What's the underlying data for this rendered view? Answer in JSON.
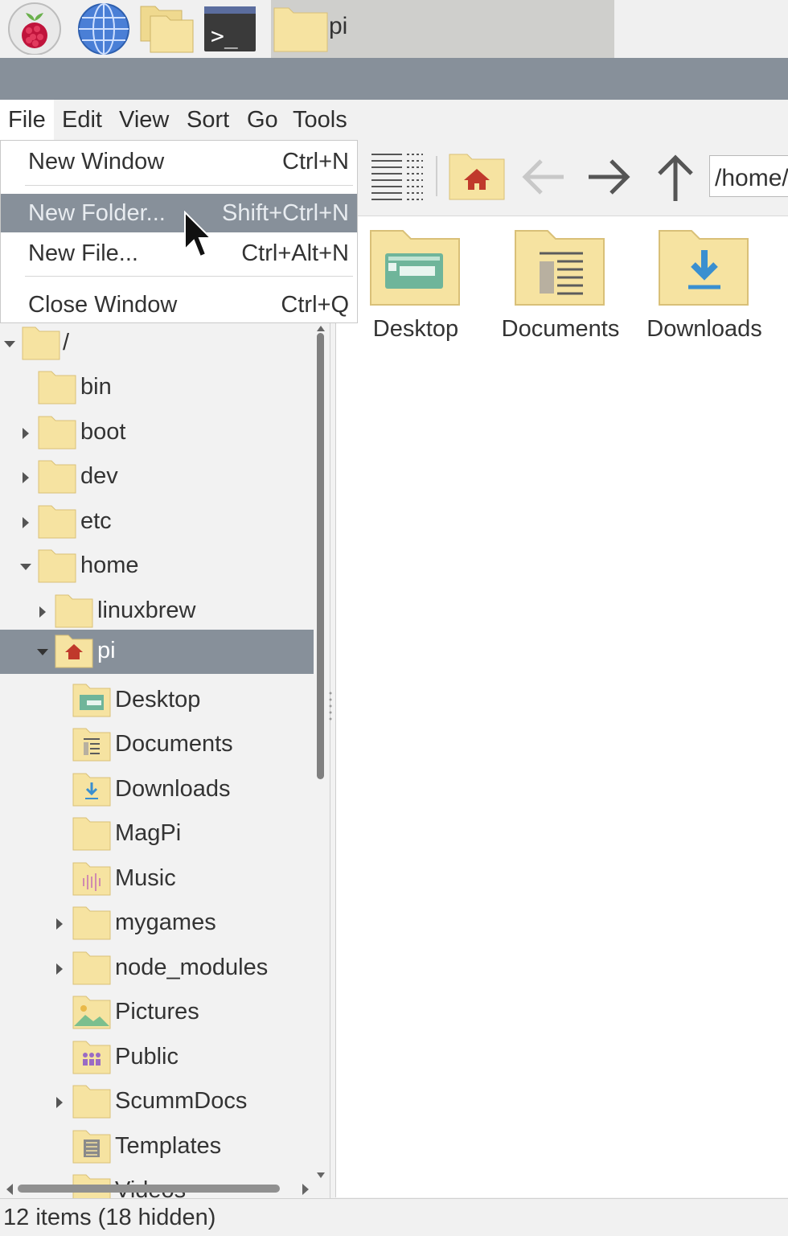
{
  "taskbar": {
    "launchers": [
      "raspberry-menu",
      "web-browser",
      "file-manager",
      "terminal"
    ],
    "terminal_glyph": ">_",
    "task_label": "pi"
  },
  "menubar": {
    "items": [
      "File",
      "Edit",
      "View",
      "Sort",
      "Go",
      "Tools"
    ]
  },
  "file_menu": {
    "items": [
      {
        "label": "New Window",
        "accel": "Ctrl+N"
      },
      {
        "label": "New Folder...",
        "accel": "Shift+Ctrl+N"
      },
      {
        "label": "New File...",
        "accel": "Ctrl+Alt+N"
      },
      {
        "label": "Close Window",
        "accel": "Ctrl+Q"
      }
    ]
  },
  "toolbar": {
    "path_value": "/home/pi"
  },
  "main": {
    "items": [
      {
        "label": "Desktop",
        "icon": "desktop-folder-icon"
      },
      {
        "label": "Documents",
        "icon": "documents-folder-icon"
      },
      {
        "label": "Downloads",
        "icon": "downloads-folder-icon"
      }
    ]
  },
  "tree": {
    "rows": [
      {
        "label": "/"
      },
      {
        "label": "bin"
      },
      {
        "label": "boot"
      },
      {
        "label": "dev"
      },
      {
        "label": "etc"
      },
      {
        "label": "home"
      },
      {
        "label": "linuxbrew"
      },
      {
        "label": "pi"
      },
      {
        "label": "Desktop"
      },
      {
        "label": "Documents"
      },
      {
        "label": "Downloads"
      },
      {
        "label": "MagPi"
      },
      {
        "label": "Music"
      },
      {
        "label": "mygames"
      },
      {
        "label": "node_modules"
      },
      {
        "label": "Pictures"
      },
      {
        "label": "Public"
      },
      {
        "label": "ScummDocs"
      },
      {
        "label": "Templates"
      },
      {
        "label": "Videos"
      }
    ]
  },
  "status": {
    "text": "12 items (18 hidden)"
  },
  "colors": {
    "folder": "#f6e3a1",
    "folder_stroke": "#d9c078",
    "selection": "#87909a",
    "home_red": "#c0392b"
  }
}
